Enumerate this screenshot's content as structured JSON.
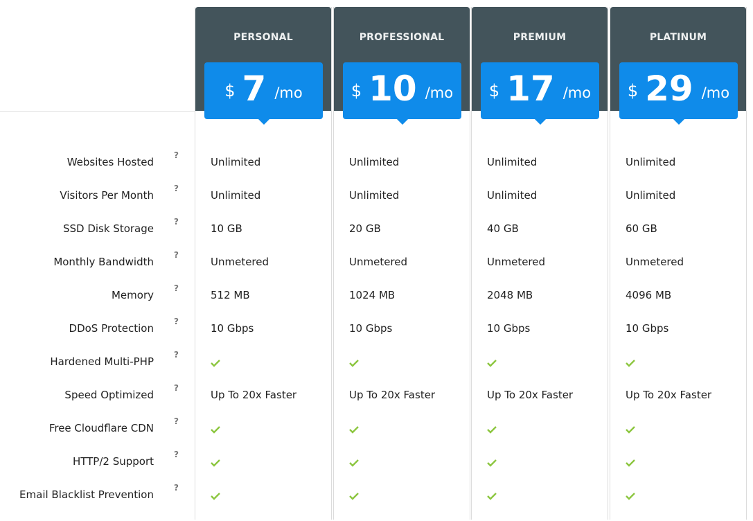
{
  "features": [
    {
      "label": "Websites Hosted",
      "help": "?"
    },
    {
      "label": "Visitors Per Month",
      "help": "?"
    },
    {
      "label": "SSD Disk Storage",
      "help": "?"
    },
    {
      "label": "Monthly Bandwidth",
      "help": "?"
    },
    {
      "label": "Memory",
      "help": "?"
    },
    {
      "label": "DDoS Protection",
      "help": "?"
    },
    {
      "label": "Hardened Multi-PHP",
      "help": "?"
    },
    {
      "label": "Speed Optimized",
      "help": "?"
    },
    {
      "label": "Free Cloudflare CDN",
      "help": "?"
    },
    {
      "label": "HTTP/2 Support",
      "help": "?"
    },
    {
      "label": "Email Blacklist Prevention",
      "help": "?"
    }
  ],
  "plans": [
    {
      "name": "PERSONAL",
      "currency": "$",
      "price": "7",
      "period": "/mo",
      "values": [
        "Unlimited",
        "Unlimited",
        "10 GB",
        "Unmetered",
        "512 MB",
        "10 Gbps",
        "check-icon",
        "Up To 20x Faster",
        "check-icon",
        "check-icon",
        "check-icon"
      ]
    },
    {
      "name": "PROFESSIONAL",
      "currency": "$",
      "price": "10",
      "period": "/mo",
      "values": [
        "Unlimited",
        "Unlimited",
        "20 GB",
        "Unmetered",
        "1024 MB",
        "10 Gbps",
        "check-icon",
        "Up To 20x Faster",
        "check-icon",
        "check-icon",
        "check-icon"
      ]
    },
    {
      "name": "PREMIUM",
      "currency": "$",
      "price": "17",
      "period": "/mo",
      "values": [
        "Unlimited",
        "Unlimited",
        "40 GB",
        "Unmetered",
        "2048 MB",
        "10 Gbps",
        "check-icon",
        "Up To 20x Faster",
        "check-icon",
        "check-icon",
        "check-icon"
      ]
    },
    {
      "name": "PLATINUM",
      "currency": "$",
      "price": "29",
      "period": "/mo",
      "values": [
        "Unlimited",
        "Unlimited",
        "60 GB",
        "Unmetered",
        "4096 MB",
        "10 Gbps",
        "check-icon",
        "Up To 20x Faster",
        "check-icon",
        "check-icon",
        "check-icon"
      ]
    }
  ],
  "colors": {
    "header_bg": "#43545b",
    "price_bg": "#0f8bea",
    "check": "#8cc63f"
  }
}
